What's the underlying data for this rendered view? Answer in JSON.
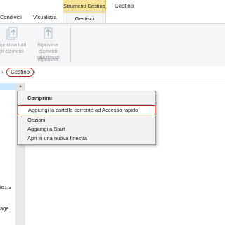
{
  "window": {
    "context_group": "Strumenti Cestino",
    "title": "Cestino"
  },
  "tabs": {
    "condividi": "Condividi",
    "visualizza": "Visualizza",
    "gestisci": "Gestisci"
  },
  "ribbon": {
    "restore_all_line1": "Ripristina tutti",
    "restore_all_line2": "gli elementi",
    "restore_selected_line1": "Ripristina elementi",
    "restore_selected_line2": "selezionati",
    "group_label": "Ripristina"
  },
  "address": {
    "location": "Cestino"
  },
  "nav": {
    "partial_label_1": "io1.3",
    "partial_label_2": "age"
  },
  "context_menu": {
    "items": [
      "Comprimi",
      "Aggiungi la cartella corrente ad Accesso rapido",
      "Opzioni",
      "Aggiungi a Start",
      "Apri in una nuova finestra"
    ]
  },
  "colors": {
    "context_tab_accent": "#f7e59a",
    "highlight_border": "#b3261e",
    "nav_selection": "#cce8ff"
  }
}
